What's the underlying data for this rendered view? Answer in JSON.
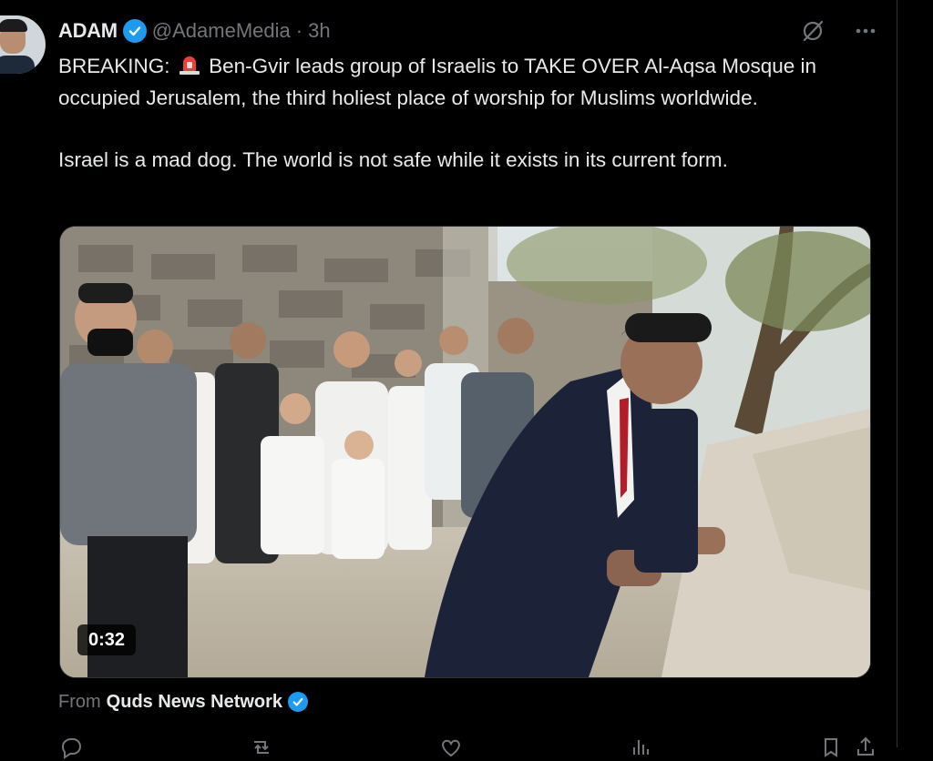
{
  "tweet": {
    "author_name": "ADAM",
    "author_handle": "@AdameMedia",
    "separator": "·",
    "time": "3h",
    "text_before_emoji": "BREAKING:",
    "text_after_emoji": "Ben-Gvir leads group of Israelis to TAKE OVER Al-Aqsa Mosque in occupied Jerusalem, the third holiest place of worship for Muslims worldwide.",
    "paragraph2": "Israel is a mad dog. The world is not safe while it exists in its current form.",
    "emoji": "police-car-light-emoji"
  },
  "media": {
    "video_duration": "0:32"
  },
  "source": {
    "from_label": "From",
    "name": "Quds News Network"
  },
  "actions": {
    "reply_count": "",
    "repost_count": "",
    "like_count": "",
    "views_count": ""
  },
  "colors": {
    "background": "#000000",
    "text": "#e7e9ea",
    "muted": "#71767b",
    "verified": "#1d9bf0"
  },
  "icons": {
    "verified": "verified-badge-icon",
    "grok": "grok-icon",
    "more": "more-icon",
    "reply": "reply-icon",
    "repost": "repost-icon",
    "like": "like-icon",
    "views": "views-icon",
    "bookmark": "bookmark-icon",
    "share": "share-icon"
  }
}
